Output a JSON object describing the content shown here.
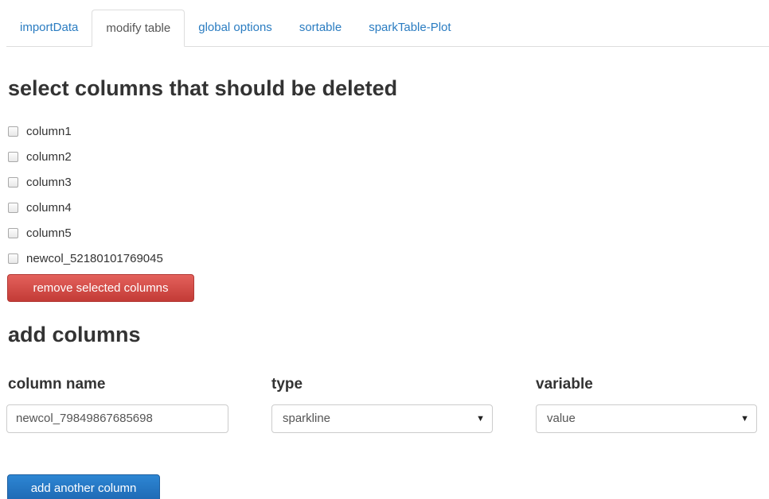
{
  "tabs": [
    {
      "label": "importData",
      "active": false
    },
    {
      "label": "modify table",
      "active": true
    },
    {
      "label": "global options",
      "active": false
    },
    {
      "label": "sortable",
      "active": false
    },
    {
      "label": "sparkTable-Plot",
      "active": false
    }
  ],
  "delete_section": {
    "heading": "select columns that should be deleted",
    "columns": [
      "column1",
      "column2",
      "column3",
      "column4",
      "column5",
      "newcol_52180101769045"
    ],
    "remove_button": "remove selected columns"
  },
  "add_section": {
    "heading": "add columns",
    "column_name": {
      "label": "column name",
      "value": "newcol_79849867685698"
    },
    "type": {
      "label": "type",
      "value": "sparkline"
    },
    "variable": {
      "label": "variable",
      "value": "value"
    },
    "add_button": "add another column"
  },
  "colors": {
    "link": "#2a7cc1",
    "danger": "#d9534f",
    "primary": "#2a7cc1"
  }
}
